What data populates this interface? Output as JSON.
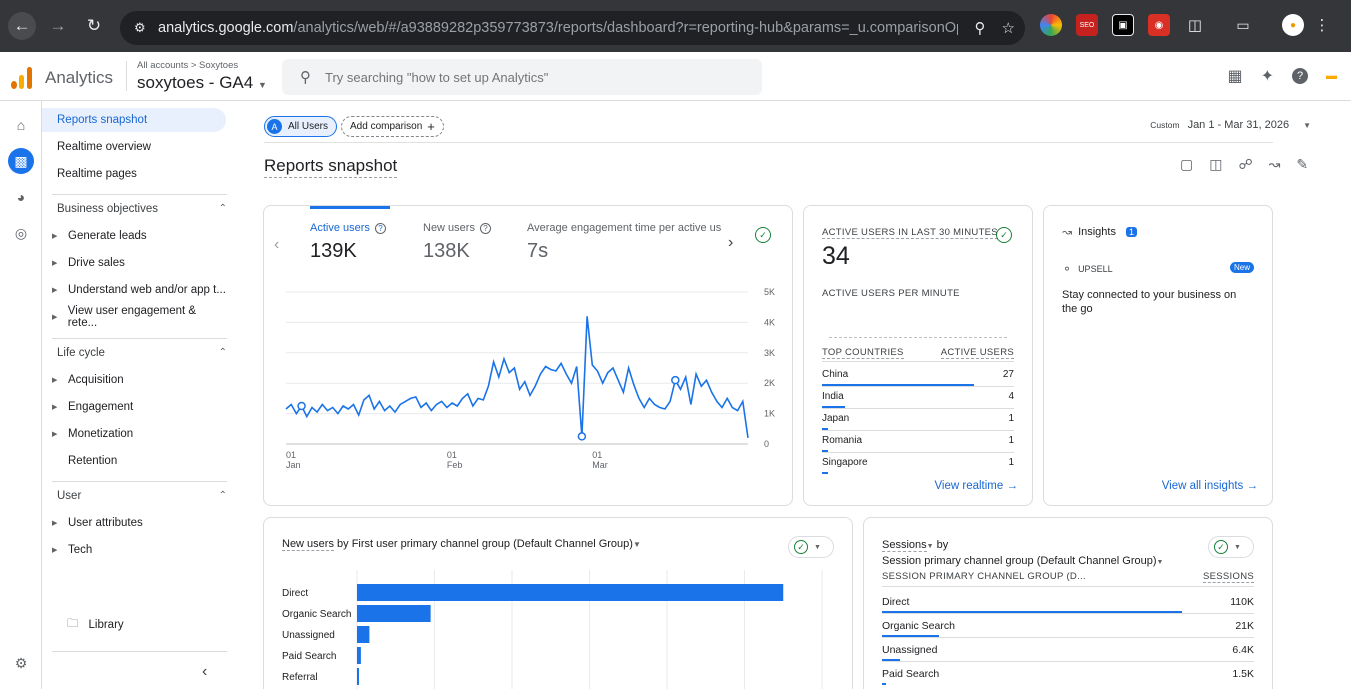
{
  "browser": {
    "url_host": "analytics.google.com",
    "url_path": "/analytics/web/#/a93889282p359773873/reports/dashboard?r=reporting-hub&params=_u.comparisonOp..."
  },
  "header": {
    "app_title": "Analytics",
    "account_path": "All accounts > Soxytoes",
    "property_name": "soxytoes - GA4",
    "search_placeholder": "Try searching \"how to set up Analytics\""
  },
  "nav": {
    "top_items": [
      "Reports snapshot",
      "Realtime overview",
      "Realtime pages"
    ],
    "business_objectives": {
      "title": "Business objectives",
      "items": [
        "Generate leads",
        "Drive sales",
        "Understand web and/or app t...",
        "View user engagement & rete..."
      ]
    },
    "life_cycle": {
      "title": "Life cycle",
      "items": [
        "Acquisition",
        "Engagement",
        "Monetization",
        "Retention"
      ]
    },
    "user": {
      "title": "User",
      "items": [
        "User attributes",
        "Tech"
      ]
    },
    "library": "Library"
  },
  "main": {
    "chip_all_users": "All Users",
    "chip_all_users_initial": "A",
    "chip_add_comparison": "Add comparison",
    "date_custom": "Custom",
    "date_range": "Jan 1 - Mar 31, 2026",
    "page_title": "Reports snapshot"
  },
  "overview_card": {
    "metrics": [
      {
        "label": "Active users",
        "value": "139K"
      },
      {
        "label": "New users",
        "value": "138K"
      },
      {
        "label": "Average engagement time per active us",
        "value": "7s"
      }
    ],
    "y_ticks": [
      "5K",
      "4K",
      "3K",
      "2K",
      "1K",
      "0"
    ],
    "x_ticks": [
      {
        "day": "01",
        "month": "Jan"
      },
      {
        "day": "01",
        "month": "Feb"
      },
      {
        "day": "01",
        "month": "Mar"
      }
    ]
  },
  "realtime_card": {
    "title": "ACTIVE USERS IN LAST 30 MINUTES",
    "value": "34",
    "per_minute_label": "ACTIVE USERS PER MINUTE",
    "col_country": "TOP COUNTRIES",
    "col_users": "ACTIVE USERS",
    "rows": [
      {
        "country": "China",
        "users": "27",
        "share": 0.79
      },
      {
        "country": "India",
        "users": "4",
        "share": 0.12
      },
      {
        "country": "Japan",
        "users": "1",
        "share": 0.03
      },
      {
        "country": "Romania",
        "users": "1",
        "share": 0.03
      },
      {
        "country": "Singapore",
        "users": "1",
        "share": 0.03
      }
    ],
    "link": "View realtime"
  },
  "insights_card": {
    "title": "Insights",
    "badge": "1",
    "tag": "UPSELL",
    "new_badge": "New",
    "text": "Stay connected to your business on the go",
    "link": "View all insights"
  },
  "new_users_card": {
    "title_metric": "New users",
    "title_rest": " by First user primary channel group (Default Channel Group)"
  },
  "sessions_card": {
    "title_metric": "Sessions",
    "title_by": " by",
    "title_dim": "Session primary channel group (Default Channel Group)",
    "col_dim": "SESSION PRIMARY CHANNEL GROUP (D...",
    "col_metric": "SESSIONS",
    "rows": [
      {
        "label": "Direct",
        "value": "110K",
        "share": 1.0
      },
      {
        "label": "Organic Search",
        "value": "21K",
        "share": 0.19
      },
      {
        "label": "Unassigned",
        "value": "6.4K",
        "share": 0.06
      },
      {
        "label": "Paid Search",
        "value": "1.5K",
        "share": 0.014
      }
    ]
  },
  "chart_data": [
    {
      "type": "line",
      "series": [
        {
          "name": "Active users",
          "values": [
            1150,
            1300,
            1000,
            1250,
            900,
            1200,
            1050,
            1300,
            1100,
            1200,
            1000,
            1250,
            1150,
            1300,
            950,
            1450,
            1600,
            1150,
            1400,
            1100,
            1250,
            1050,
            1300,
            1400,
            1500,
            1550,
            1200,
            1350,
            1100,
            1300,
            1400,
            1200,
            1350,
            1250,
            1500,
            1650,
            1250,
            1500,
            1450,
            1900,
            2700,
            2200,
            2800,
            2350,
            2500,
            1800,
            2050,
            1600,
            1900,
            2300,
            2550,
            2450,
            2400,
            2650,
            2300,
            2000,
            2550,
            250,
            4200,
            2600,
            2400,
            2000,
            2350,
            2500,
            2100,
            1700,
            2500,
            1950,
            1500,
            1200,
            1500,
            1300,
            1200,
            1150,
            1400,
            2100,
            1800,
            2200,
            1300,
            2300,
            1900,
            2100,
            1700,
            1400,
            1200,
            1500,
            1200,
            1100,
            1400,
            200
          ]
        }
      ],
      "x_ticks": [
        "01 Jan",
        "01 Feb",
        "01 Mar"
      ],
      "ylim": [
        0,
        5000
      ]
    },
    {
      "type": "bar",
      "orientation": "horizontal",
      "categories": [
        "Direct",
        "Organic Search",
        "Unassigned",
        "Paid Search",
        "Referral"
      ],
      "values": [
        110000,
        19000,
        3200,
        1000,
        400
      ]
    }
  ]
}
